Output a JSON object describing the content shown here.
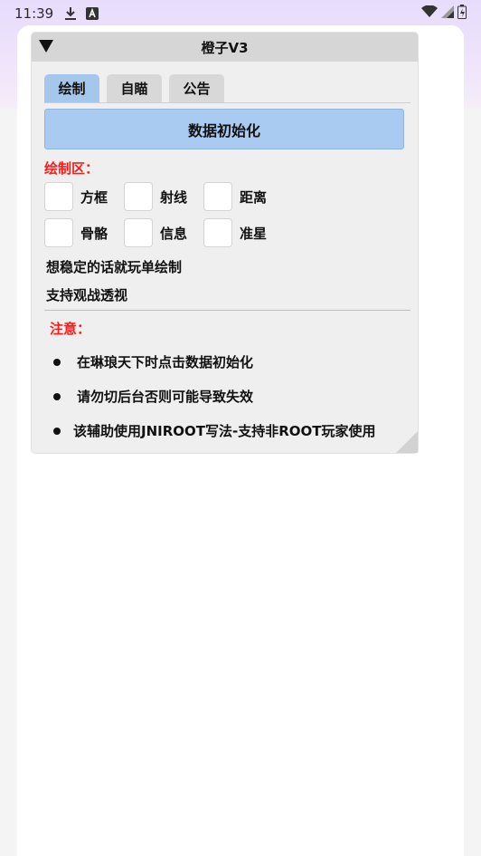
{
  "status_bar": {
    "time": "11:39",
    "icons": [
      "download-icon",
      "app-a-icon"
    ],
    "right_icons": [
      "wifi-icon",
      "signal-icon",
      "battery-icon"
    ]
  },
  "panel": {
    "title": "橙子V3",
    "tabs": [
      {
        "label": "绘制",
        "active": true
      },
      {
        "label": "自瞄",
        "active": false
      },
      {
        "label": "公告",
        "active": false
      }
    ],
    "init_button": "数据初始化",
    "draw_section_title": "绘制区：",
    "checkboxes_row1": [
      {
        "label": "方框",
        "checked": false
      },
      {
        "label": "射线",
        "checked": false
      },
      {
        "label": "距离",
        "checked": false
      }
    ],
    "checkboxes_row2": [
      {
        "label": "骨骼",
        "checked": false
      },
      {
        "label": "信息",
        "checked": false
      },
      {
        "label": "准星",
        "checked": false
      }
    ],
    "line1": "想稳定的话就玩单绘制",
    "line2": "支持观战透视",
    "notes_title": "注意：",
    "notes": [
      "在琳琅天下时点击数据初始化",
      "请勿切后台否则可能导致失效",
      "该辅助使用JNIROOT写法-支持非ROOT玩家使用"
    ]
  },
  "colors": {
    "accent_tab": "#a6c7ec",
    "button": "#a9cbf1",
    "warning_red": "#ff1a1a"
  }
}
